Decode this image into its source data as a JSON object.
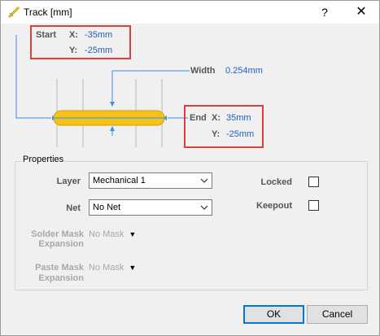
{
  "window": {
    "title": "Track [mm]"
  },
  "titlebar": {
    "help_label": "?",
    "close_label": "✕"
  },
  "start": {
    "label": "Start",
    "x_label": "X:",
    "x_value": "-35mm",
    "y_label": "Y:",
    "y_value": "-25mm"
  },
  "end": {
    "label": "End",
    "x_label": "X:",
    "x_value": "35mm",
    "y_label": "Y:",
    "y_value": "-25mm"
  },
  "width": {
    "label": "Width",
    "value": "0.254mm"
  },
  "properties": {
    "title": "Properties",
    "layer": {
      "label": "Layer",
      "value": "Mechanical 1"
    },
    "net": {
      "label": "Net",
      "value": "No Net"
    },
    "locked": {
      "label": "Locked",
      "checked": false
    },
    "keepout": {
      "label": "Keepout",
      "checked": false
    },
    "solder_mask": {
      "label_line1": "Solder Mask",
      "label_line2": "Expansion",
      "value": "No Mask"
    },
    "paste_mask": {
      "label_line1": "Paste Mask",
      "label_line2": "Expansion",
      "value": "No Mask"
    }
  },
  "buttons": {
    "ok": "OK",
    "cancel": "Cancel"
  },
  "colors": {
    "track_fill": "#f5c21b",
    "dimension_line": "#3a8ee6",
    "highlight_box": "#e23b3b",
    "value_text": "#1f5fbf"
  }
}
